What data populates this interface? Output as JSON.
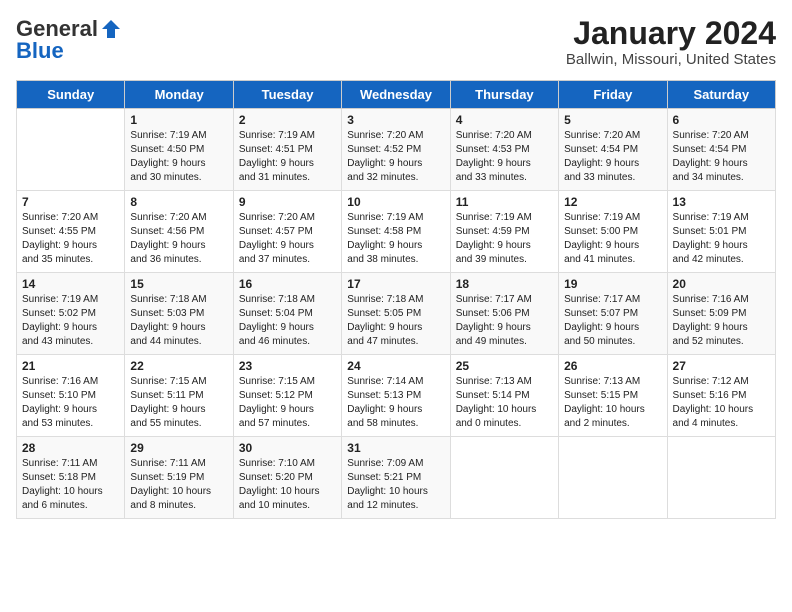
{
  "header": {
    "logo_general": "General",
    "logo_blue": "Blue",
    "main_title": "January 2024",
    "subtitle": "Ballwin, Missouri, United States"
  },
  "columns": [
    "Sunday",
    "Monday",
    "Tuesday",
    "Wednesday",
    "Thursday",
    "Friday",
    "Saturday"
  ],
  "weeks": [
    [
      {
        "day": "",
        "info": ""
      },
      {
        "day": "1",
        "info": "Sunrise: 7:19 AM\nSunset: 4:50 PM\nDaylight: 9 hours\nand 30 minutes."
      },
      {
        "day": "2",
        "info": "Sunrise: 7:19 AM\nSunset: 4:51 PM\nDaylight: 9 hours\nand 31 minutes."
      },
      {
        "day": "3",
        "info": "Sunrise: 7:20 AM\nSunset: 4:52 PM\nDaylight: 9 hours\nand 32 minutes."
      },
      {
        "day": "4",
        "info": "Sunrise: 7:20 AM\nSunset: 4:53 PM\nDaylight: 9 hours\nand 33 minutes."
      },
      {
        "day": "5",
        "info": "Sunrise: 7:20 AM\nSunset: 4:54 PM\nDaylight: 9 hours\nand 33 minutes."
      },
      {
        "day": "6",
        "info": "Sunrise: 7:20 AM\nSunset: 4:54 PM\nDaylight: 9 hours\nand 34 minutes."
      }
    ],
    [
      {
        "day": "7",
        "info": "Sunrise: 7:20 AM\nSunset: 4:55 PM\nDaylight: 9 hours\nand 35 minutes."
      },
      {
        "day": "8",
        "info": "Sunrise: 7:20 AM\nSunset: 4:56 PM\nDaylight: 9 hours\nand 36 minutes."
      },
      {
        "day": "9",
        "info": "Sunrise: 7:20 AM\nSunset: 4:57 PM\nDaylight: 9 hours\nand 37 minutes."
      },
      {
        "day": "10",
        "info": "Sunrise: 7:19 AM\nSunset: 4:58 PM\nDaylight: 9 hours\nand 38 minutes."
      },
      {
        "day": "11",
        "info": "Sunrise: 7:19 AM\nSunset: 4:59 PM\nDaylight: 9 hours\nand 39 minutes."
      },
      {
        "day": "12",
        "info": "Sunrise: 7:19 AM\nSunset: 5:00 PM\nDaylight: 9 hours\nand 41 minutes."
      },
      {
        "day": "13",
        "info": "Sunrise: 7:19 AM\nSunset: 5:01 PM\nDaylight: 9 hours\nand 42 minutes."
      }
    ],
    [
      {
        "day": "14",
        "info": "Sunrise: 7:19 AM\nSunset: 5:02 PM\nDaylight: 9 hours\nand 43 minutes."
      },
      {
        "day": "15",
        "info": "Sunrise: 7:18 AM\nSunset: 5:03 PM\nDaylight: 9 hours\nand 44 minutes."
      },
      {
        "day": "16",
        "info": "Sunrise: 7:18 AM\nSunset: 5:04 PM\nDaylight: 9 hours\nand 46 minutes."
      },
      {
        "day": "17",
        "info": "Sunrise: 7:18 AM\nSunset: 5:05 PM\nDaylight: 9 hours\nand 47 minutes."
      },
      {
        "day": "18",
        "info": "Sunrise: 7:17 AM\nSunset: 5:06 PM\nDaylight: 9 hours\nand 49 minutes."
      },
      {
        "day": "19",
        "info": "Sunrise: 7:17 AM\nSunset: 5:07 PM\nDaylight: 9 hours\nand 50 minutes."
      },
      {
        "day": "20",
        "info": "Sunrise: 7:16 AM\nSunset: 5:09 PM\nDaylight: 9 hours\nand 52 minutes."
      }
    ],
    [
      {
        "day": "21",
        "info": "Sunrise: 7:16 AM\nSunset: 5:10 PM\nDaylight: 9 hours\nand 53 minutes."
      },
      {
        "day": "22",
        "info": "Sunrise: 7:15 AM\nSunset: 5:11 PM\nDaylight: 9 hours\nand 55 minutes."
      },
      {
        "day": "23",
        "info": "Sunrise: 7:15 AM\nSunset: 5:12 PM\nDaylight: 9 hours\nand 57 minutes."
      },
      {
        "day": "24",
        "info": "Sunrise: 7:14 AM\nSunset: 5:13 PM\nDaylight: 9 hours\nand 58 minutes."
      },
      {
        "day": "25",
        "info": "Sunrise: 7:13 AM\nSunset: 5:14 PM\nDaylight: 10 hours\nand 0 minutes."
      },
      {
        "day": "26",
        "info": "Sunrise: 7:13 AM\nSunset: 5:15 PM\nDaylight: 10 hours\nand 2 minutes."
      },
      {
        "day": "27",
        "info": "Sunrise: 7:12 AM\nSunset: 5:16 PM\nDaylight: 10 hours\nand 4 minutes."
      }
    ],
    [
      {
        "day": "28",
        "info": "Sunrise: 7:11 AM\nSunset: 5:18 PM\nDaylight: 10 hours\nand 6 minutes."
      },
      {
        "day": "29",
        "info": "Sunrise: 7:11 AM\nSunset: 5:19 PM\nDaylight: 10 hours\nand 8 minutes."
      },
      {
        "day": "30",
        "info": "Sunrise: 7:10 AM\nSunset: 5:20 PM\nDaylight: 10 hours\nand 10 minutes."
      },
      {
        "day": "31",
        "info": "Sunrise: 7:09 AM\nSunset: 5:21 PM\nDaylight: 10 hours\nand 12 minutes."
      },
      {
        "day": "",
        "info": ""
      },
      {
        "day": "",
        "info": ""
      },
      {
        "day": "",
        "info": ""
      }
    ]
  ]
}
